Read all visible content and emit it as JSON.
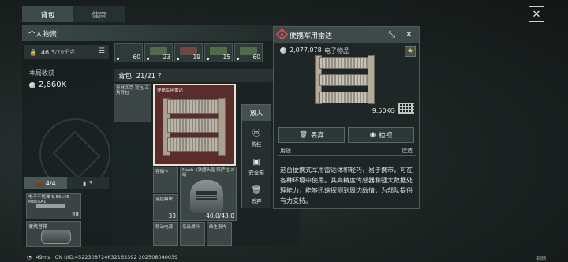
{
  "tabs": [
    "背包",
    "健康"
  ],
  "personal": {
    "header": "个人物资",
    "weight_value": "46.3",
    "weight_unit": "/76千克",
    "income_label": "本局收获",
    "income_value": "2,660K",
    "equip_tab1_count": "4/4",
    "equip_tab2_count": "3",
    "eq_slot1_label": "电子干扰弹 5.56x45 M855A1",
    "eq_slot1_count": "48",
    "eq_slot2_label": "便携音箱"
  },
  "ammo_slots": [
    "60",
    "23",
    "19",
    "15",
    "60"
  ],
  "backpack": {
    "title": "背包: 21/21  ?",
    "item_small1_label": "奥林匹克 背包 三角背包",
    "item_main_label": "便携军用雷达",
    "cell1_label": "存储卡",
    "cell2_label": "遥控模块",
    "cell2_count": "33",
    "helm_label": "Mask-1铁壁头盔 阿萨拉 2级",
    "helm_durability": "40.0/43.0",
    "cell3_label": "移动电源",
    "cell4_label": "低级燃料",
    "cell5_label": "维生素片"
  },
  "context_menu": {
    "header": "放入",
    "items": [
      "购挂",
      "安全箱",
      "丢弃"
    ]
  },
  "detail": {
    "title": "便携军用雷达",
    "price": "2,077,078",
    "category": "电子物品",
    "weight": "9.50KG",
    "discard_label": "丢弃",
    "inspect_label": "检视",
    "usage_left": "用途",
    "usage_right": "建造",
    "description": "这台便携式军用雷达体积轻巧，易于携带，可在各种环境中使用。其高精度传感器和强大数据处理能力，能够迅速探测到周边敌情，为部队提供有力支持。"
  },
  "status": {
    "ping": "49ms",
    "uid": "CN UID:4522308724632163392 202508040039",
    "corner": "视频"
  }
}
